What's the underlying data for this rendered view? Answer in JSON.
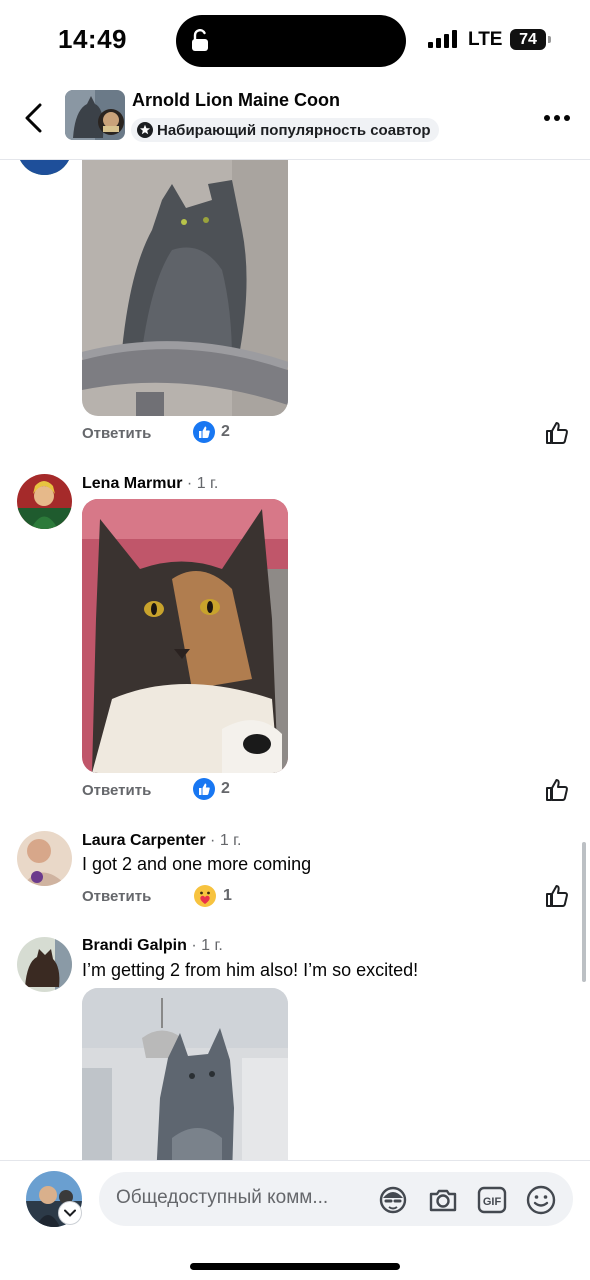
{
  "status": {
    "time": "14:49",
    "network": "LTE",
    "battery": "74"
  },
  "header": {
    "title": "Arnold Lion Maine Coon",
    "badge": "Набирающий популярность соавтор",
    "icons": {
      "back": "chevron-left-icon",
      "more": "more-dots-icon",
      "badge": "star-icon"
    }
  },
  "comments": [
    {
      "name": "",
      "time": "",
      "text": "",
      "image": "grey maine coon on cat tree",
      "reply_label": "Ответить",
      "reaction": {
        "type": "like",
        "count": "2"
      }
    },
    {
      "name": "Lena Marmur",
      "time": "· 1 г.",
      "text": "",
      "image": "tortoiseshell maine coon",
      "reply_label": "Ответить",
      "reaction": {
        "type": "like",
        "count": "2"
      }
    },
    {
      "name": "Laura Carpenter",
      "time": "· 1 г.",
      "text": "I got 2 and one more coming",
      "image": "",
      "reply_label": "Ответить",
      "reaction": {
        "type": "care",
        "count": "1"
      }
    },
    {
      "name": "Brandi Galpin",
      "time": "· 1 г.",
      "text": "I’m getting 2 from him also! I’m so excited!",
      "image": "grey maine coon kitten"
    }
  ],
  "composer": {
    "placeholder": "Общедоступный комм...",
    "icons": [
      "avatar-sticker-icon",
      "camera-icon",
      "gif-icon",
      "emoji-icon"
    ]
  },
  "colors": {
    "accent": "#1877f2",
    "muted": "#65676b",
    "pill": "#f0f2f5"
  }
}
